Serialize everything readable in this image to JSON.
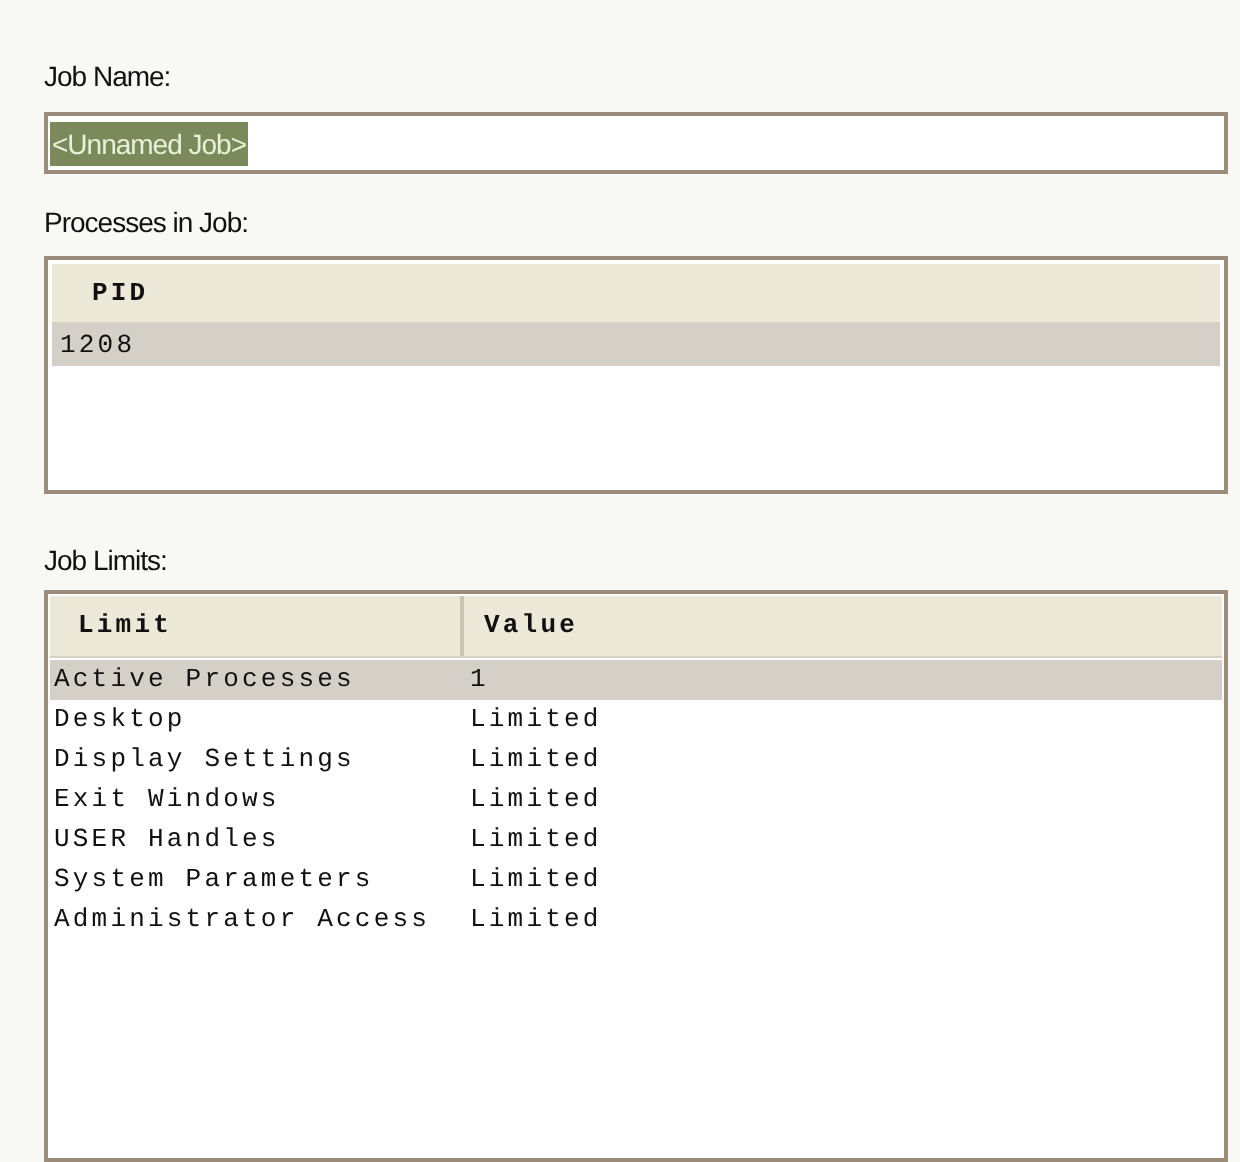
{
  "job_name": {
    "label": "Job Name:",
    "value": "<Unnamed Job>",
    "value_selected": true
  },
  "processes": {
    "label": "Processes in Job:",
    "columns": [
      "PID"
    ],
    "rows": [
      {
        "cells": [
          "1208"
        ],
        "selected": true
      }
    ]
  },
  "job_limits": {
    "label": "Job Limits:",
    "columns": [
      "Limit",
      "Value"
    ],
    "rows": [
      {
        "cells": [
          "Active Processes",
          "1"
        ],
        "selected": true
      },
      {
        "cells": [
          "Desktop",
          "Limited"
        ],
        "selected": false
      },
      {
        "cells": [
          "Display Settings",
          "Limited"
        ],
        "selected": false
      },
      {
        "cells": [
          "Exit Windows",
          "Limited"
        ],
        "selected": false
      },
      {
        "cells": [
          "USER Handles",
          "Limited"
        ],
        "selected": false
      },
      {
        "cells": [
          "System Parameters",
          "Limited"
        ],
        "selected": false
      },
      {
        "cells": [
          "Administrator Access",
          "Limited"
        ],
        "selected": false
      }
    ]
  }
}
